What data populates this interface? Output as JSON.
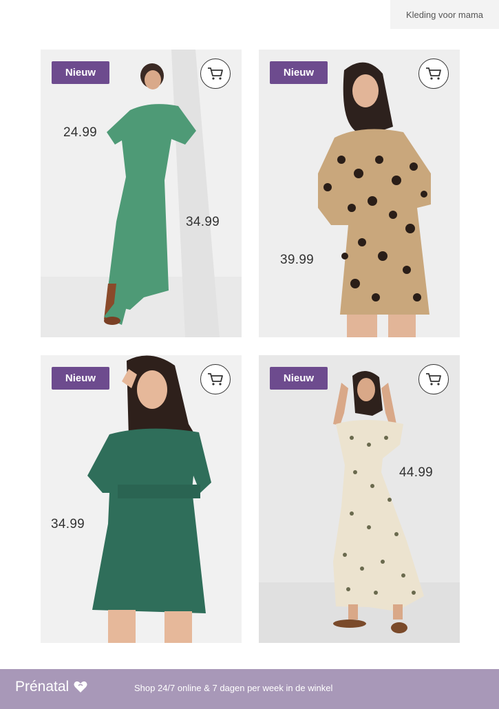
{
  "header": {
    "tab_label": "Kleding voor mama"
  },
  "products": [
    {
      "badge": "Nieuw",
      "prices": [
        "24.99",
        "34.99"
      ],
      "cart_icon": "shopping-cart-icon"
    },
    {
      "badge": "Nieuw",
      "prices": [
        "39.99"
      ],
      "cart_icon": "shopping-cart-icon"
    },
    {
      "badge": "Nieuw",
      "prices": [
        "34.99"
      ],
      "cart_icon": "shopping-cart-icon"
    },
    {
      "badge": "Nieuw",
      "prices": [
        "44.99"
      ],
      "cart_icon": "shopping-cart-icon"
    }
  ],
  "footer": {
    "brand": "Prénatal",
    "tagline": "Shop 24/7 online & 7 dagen per week in de winkel",
    "brand_icon": "heart-icon"
  },
  "colors": {
    "badge": "#6d4b8e",
    "footer": "#a898b8"
  }
}
